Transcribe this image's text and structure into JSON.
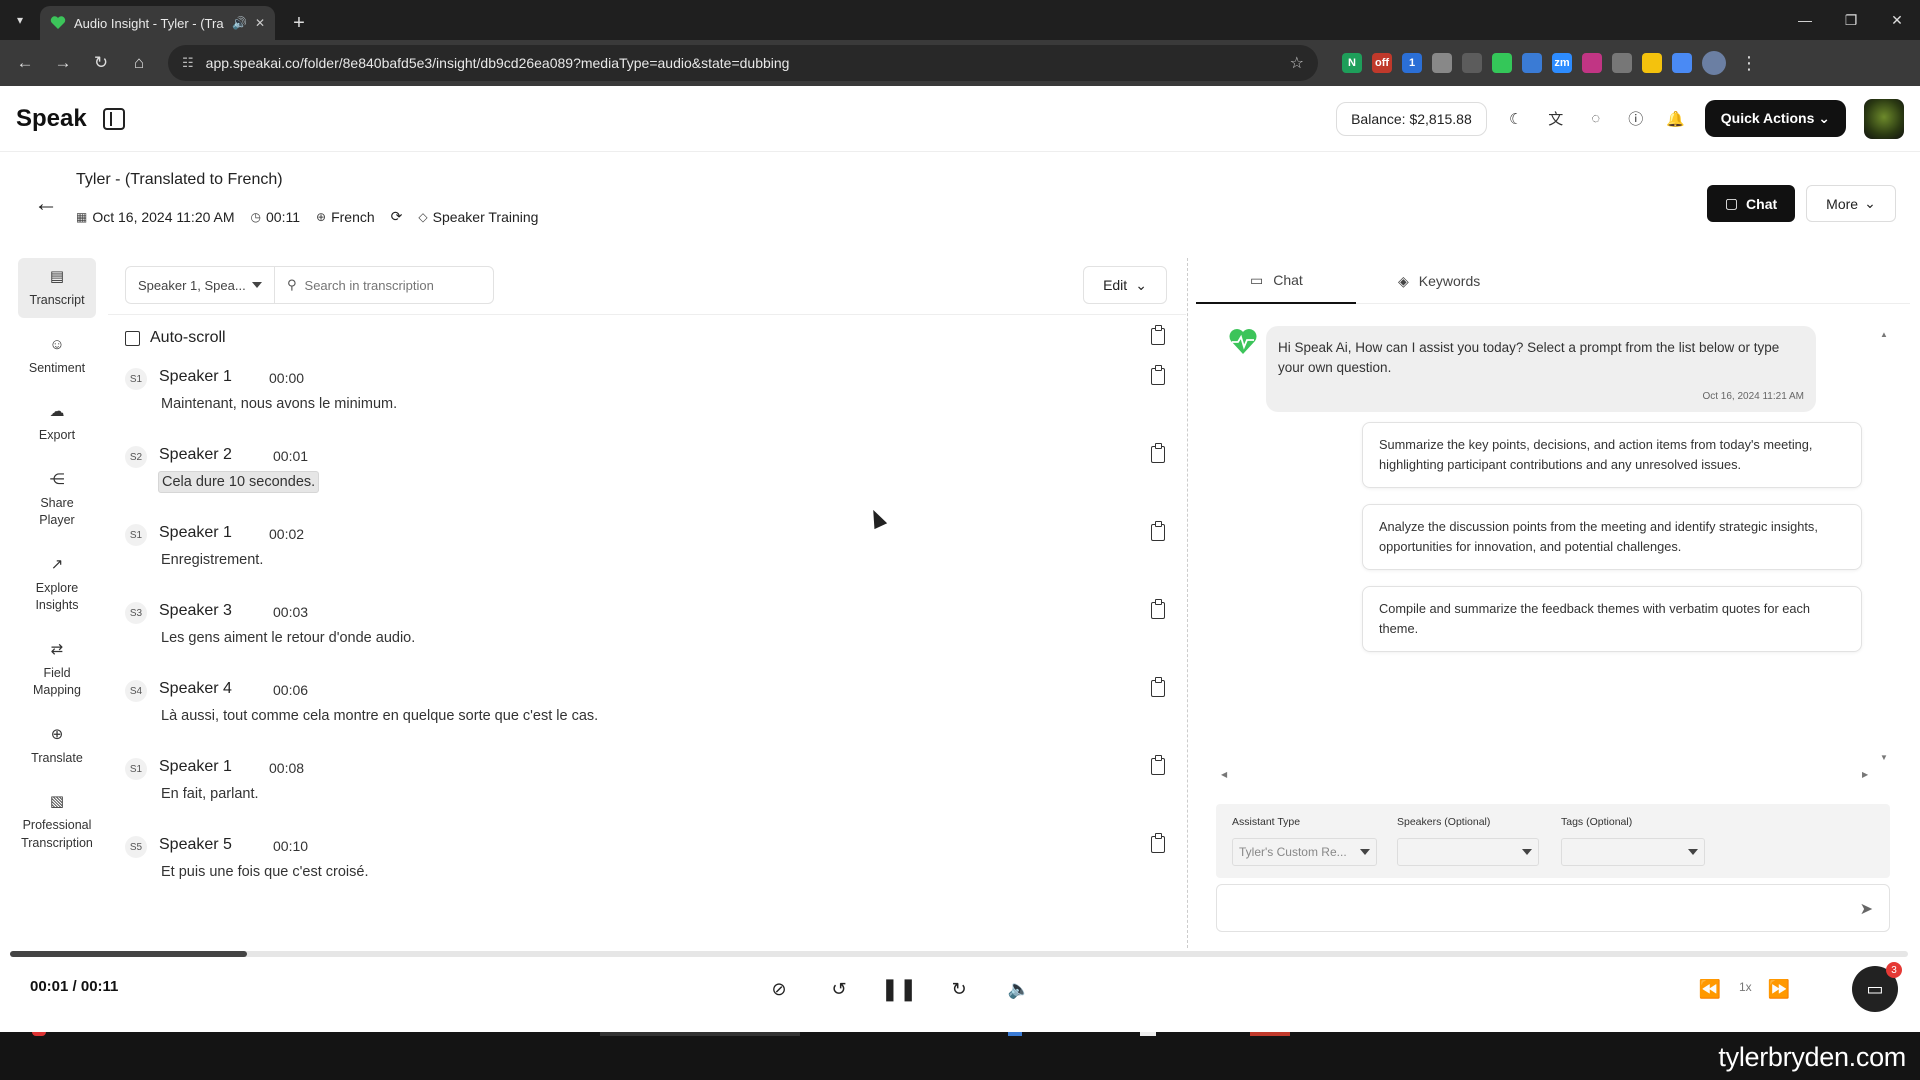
{
  "browser": {
    "tab_title": "Audio Insight - Tyler - (Tran",
    "url": "app.speakai.co/folder/8e840bafd5e3/insight/db9cd26ea089?mediaType=audio&state=dubbing",
    "extensions": [
      {
        "name": "N",
        "color": "#1e9e5a"
      },
      {
        "name": "off",
        "color": "#c0392b"
      },
      {
        "name": "1",
        "color": "#2b6fd6"
      },
      {
        "name": "",
        "color": "#888888"
      },
      {
        "name": "",
        "color": "#5c5c5c"
      },
      {
        "name": "",
        "color": "#34c759"
      },
      {
        "name": "",
        "color": "#3a7bd5"
      },
      {
        "name": "zm",
        "color": "#2d8cff"
      },
      {
        "name": "",
        "color": "#c13584"
      },
      {
        "name": "",
        "color": "#777777"
      },
      {
        "name": "",
        "color": "#f4c20d"
      },
      {
        "name": "",
        "color": "#4a8af4"
      }
    ]
  },
  "header": {
    "logo": "Speak",
    "balance": "Balance: $2,815.88",
    "quick_actions": "Quick Actions"
  },
  "page": {
    "title": "Tyler - (Translated to French)",
    "date": "Oct 16, 2024 11:20 AM",
    "duration": "00:11",
    "language": "French",
    "tag": "Speaker Training",
    "chat_button": "Chat",
    "more_button": "More"
  },
  "nav": {
    "items": [
      {
        "label": "Transcript"
      },
      {
        "label": "Sentiment"
      },
      {
        "label": "Export"
      },
      {
        "label": "Share Player"
      },
      {
        "label": "Explore Insights"
      },
      {
        "label": "Field Mapping"
      },
      {
        "label": "Translate"
      },
      {
        "label": "Professional Transcription"
      }
    ]
  },
  "transcript": {
    "speaker_filter": "Speaker 1, Spea...",
    "search_placeholder": "Search in transcription",
    "edit_label": "Edit",
    "autoscroll_label": "Auto-scroll",
    "segments": [
      {
        "badge": "S1",
        "speaker": "Speaker 1",
        "time": "00:00",
        "text": "Maintenant, nous avons le minimum."
      },
      {
        "badge": "S2",
        "speaker": "Speaker 2",
        "time": "00:01",
        "text": "Cela dure 10 secondes."
      },
      {
        "badge": "S1",
        "speaker": "Speaker 1",
        "time": "00:02",
        "text": "Enregistrement."
      },
      {
        "badge": "S3",
        "speaker": "Speaker 3",
        "time": "00:03",
        "text": "Les gens aiment le retour d'onde audio."
      },
      {
        "badge": "S4",
        "speaker": "Speaker 4",
        "time": "00:06",
        "text": "Là aussi, tout comme cela montre en quelque sorte que c'est le cas."
      },
      {
        "badge": "S1",
        "speaker": "Speaker 1",
        "time": "00:08",
        "text": "En fait, parlant."
      },
      {
        "badge": "S5",
        "speaker": "Speaker 5",
        "time": "00:10",
        "text": "Et puis une fois que c'est croisé."
      }
    ]
  },
  "chat": {
    "tab_chat": "Chat",
    "tab_keywords": "Keywords",
    "bot_message": "Hi Speak Ai, How can I assist you today? Select a prompt from the list below or type your own question.",
    "bot_timestamp": "Oct 16, 2024 11:21 AM",
    "prompts": [
      "Summarize the key points, decisions, and action items from today's meeting, highlighting participant contributions and any unresolved issues.",
      "Analyze the discussion points from the meeting and identify strategic insights, opportunities for innovation, and potential challenges.",
      "Compile and summarize the feedback themes with verbatim quotes for each theme."
    ],
    "assistant_type_label": "Assistant Type",
    "assistant_type_value": "Tyler's Custom Re...",
    "speakers_label": "Speakers (Optional)",
    "tags_label": "Tags (Optional)"
  },
  "player": {
    "time": "00:01 / 00:11",
    "speed": "1x",
    "progress_fraction": 0.125,
    "notification_count": "3"
  },
  "watermark": "tylerbryden.com",
  "colors": {
    "accent": "#111111",
    "brand_green": "#3cc45a",
    "notification_red": "#e53935"
  }
}
